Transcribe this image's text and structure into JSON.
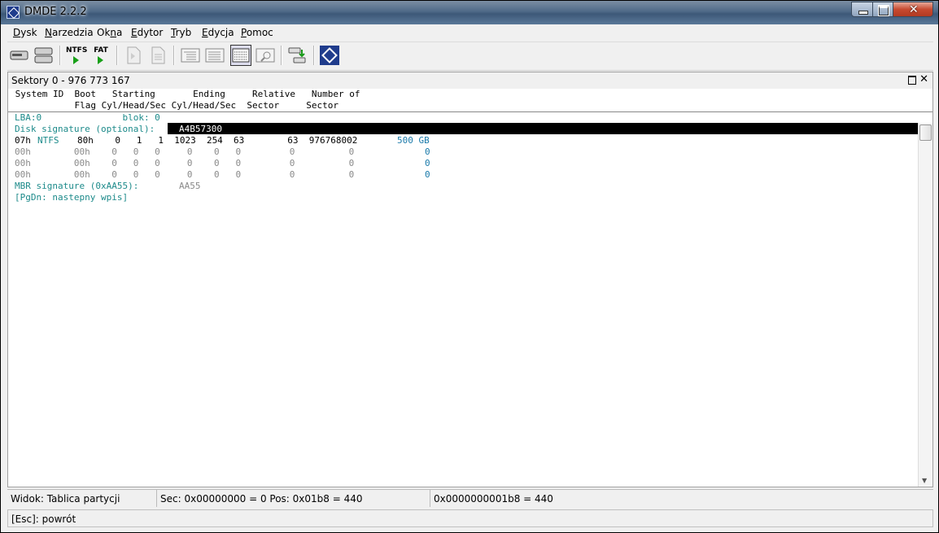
{
  "window": {
    "title": "DMDE 2.2.2"
  },
  "menu": [
    {
      "label": "Dysk",
      "ul": "D",
      "rest": "ysk"
    },
    {
      "label": "Narzedzia",
      "ul": "N",
      "rest": "arzedzia"
    },
    {
      "label": "Okna",
      "pre": "Ok",
      "ul": "n",
      "rest": "a"
    },
    {
      "label": "Edytor",
      "ul": "E",
      "rest": "dytor"
    },
    {
      "label": "Tryb",
      "ul": "T",
      "rest": "ryb"
    },
    {
      "label": "Edycja",
      "ul": "E",
      "rest": "dycja"
    },
    {
      "label": "Pomoc",
      "ul": "P",
      "rest": "omoc"
    }
  ],
  "toolbar": {
    "ntfs_label": "NTFS",
    "fat_label": "FAT"
  },
  "panel": {
    "title": "Sektory 0 - 976 773 167"
  },
  "table": {
    "header1": " System ID  Boot   Starting       Ending     Relative   Number of",
    "header2": "            Flag Cyl/Head/Sec Cyl/Head/Sec  Sector     Sector",
    "lba_line": "LBA:0               blok: 0",
    "disk_sig_label": "Disk signature (optional):",
    "disk_sig_value": "A4B57300",
    "row1_sys": "07h",
    "row1_fs": "NTFS",
    "row1_rest": "80h    0   1   1  1023  254  63        63  976768002",
    "row1_size": "500 GB",
    "rows_empty": [
      {
        "a": "00h        00h    0   0   0     0    0   0         0          0",
        "b": "0"
      },
      {
        "a": "00h        00h    0   0   0     0    0   0         0          0",
        "b": "0"
      },
      {
        "a": "00h        00h    0   0   0     0    0   0         0          0",
        "b": "0"
      }
    ],
    "mbr_label": "MBR signature (0xAA55):",
    "mbr_value": "AA55",
    "pgdn": "[PgDn: nastepny wpis]"
  },
  "status": {
    "view": "Widok: Tablica partycji",
    "sec": "Sec: 0x00000000 = 0  Pos: 0x01b8 = 440",
    "offset": "0x0000000001b8 = 440",
    "esc": "[Esc]: powrót"
  }
}
